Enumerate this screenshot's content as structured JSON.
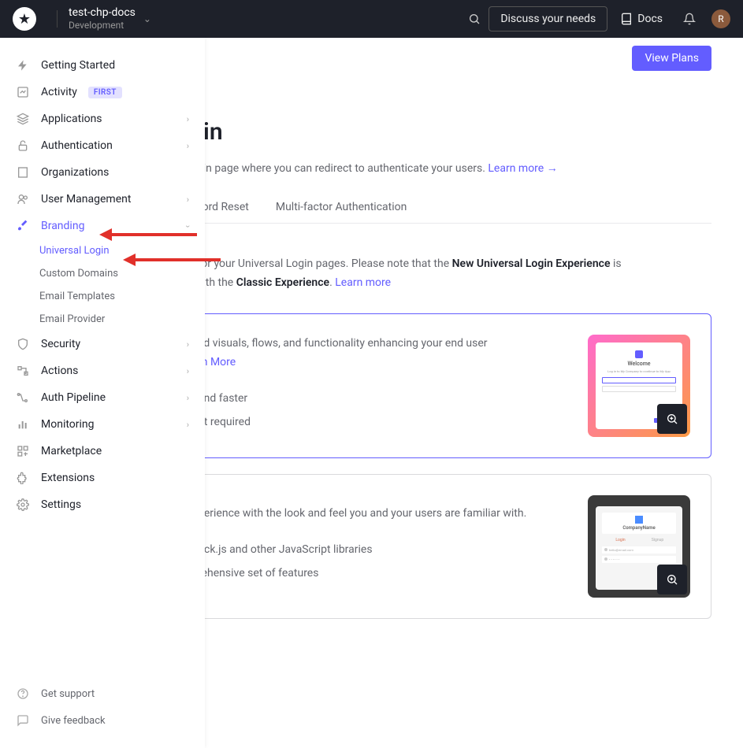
{
  "header": {
    "project_name": "test-chp-docs",
    "environment": "Development",
    "discuss_btn": "Discuss your needs",
    "docs_label": "Docs",
    "avatar_initial": "R"
  },
  "sidebar": {
    "items": [
      {
        "label": "Getting Started",
        "icon": "bolt"
      },
      {
        "label": "Activity",
        "icon": "chart",
        "badge": "FIRST"
      },
      {
        "label": "Applications",
        "icon": "stack",
        "chevron": true
      },
      {
        "label": "Authentication",
        "icon": "lock",
        "chevron": true
      },
      {
        "label": "Organizations",
        "icon": "building"
      },
      {
        "label": "User Management",
        "icon": "users",
        "chevron": true
      },
      {
        "label": "Branding",
        "icon": "brush",
        "chevron": true,
        "active": true,
        "expanded": true
      },
      {
        "label": "Security",
        "icon": "shield",
        "chevron": true
      },
      {
        "label": "Actions",
        "icon": "flow",
        "chevron": true
      },
      {
        "label": "Auth Pipeline",
        "icon": "pipeline",
        "chevron": true
      },
      {
        "label": "Monitoring",
        "icon": "bars",
        "chevron": true
      },
      {
        "label": "Marketplace",
        "icon": "grid"
      },
      {
        "label": "Extensions",
        "icon": "puzzle"
      },
      {
        "label": "Settings",
        "icon": "gear"
      }
    ],
    "branding_sub": [
      {
        "label": "Universal Login",
        "active": true
      },
      {
        "label": "Custom Domains"
      },
      {
        "label": "Email Templates"
      },
      {
        "label": "Email Provider"
      }
    ],
    "footer": [
      {
        "label": "Get support",
        "icon": "help"
      },
      {
        "label": "Give feedback",
        "icon": "chat"
      }
    ]
  },
  "main": {
    "banner_btn": "View Plans",
    "page_title_fragment": "ogin",
    "page_desc_prefix": "al login page where you can redirect to authenticate your users. ",
    "page_desc_link": "Learn more →",
    "tabs": [
      {
        "label": "assword Reset"
      },
      {
        "label": "Multi-factor Authentication"
      }
    ],
    "intro_p1": " feel for your Universal Login pages. Please note that the ",
    "intro_bold1": "New Universal Login Experience",
    "intro_p2": " is ",
    "intro_p3": "rity with the ",
    "intro_bold2": "Classic Experience",
    "intro_dot": ". ",
    "intro_link": "Learn more",
    "card1_line1": "ed visuals, flows, and functionality enhancing your end user ",
    "card1_link": "rn More",
    "card1_bul1": " and faster",
    "card1_bul2": "pt required",
    "thumb_welcome": "Welcome",
    "card2_line1": "perience with the look and feel you and your users are familiar with.",
    "card2_bul1": "ock.js and other JavaScript libraries",
    "card2_bul2": "rehensive set of features",
    "thumb_company": "CompanyName",
    "thumb_login": "Login",
    "thumb_signup": "Signup"
  }
}
